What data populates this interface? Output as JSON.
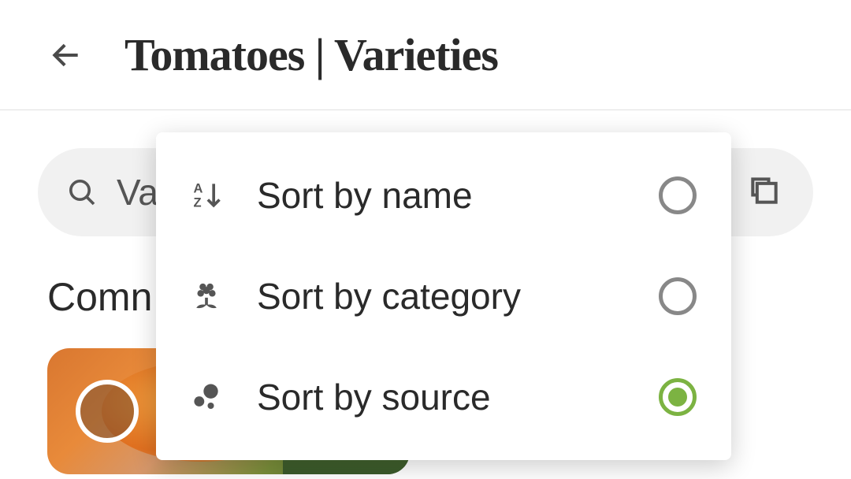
{
  "header": {
    "title": "Tomatoes | Varieties"
  },
  "search": {
    "placeholder": "Va"
  },
  "section": {
    "label": "Comn"
  },
  "sort_popup": {
    "items": [
      {
        "label": "Sort by name",
        "selected": false
      },
      {
        "label": "Sort by category",
        "selected": false
      },
      {
        "label": "Sort by source",
        "selected": true
      }
    ]
  }
}
